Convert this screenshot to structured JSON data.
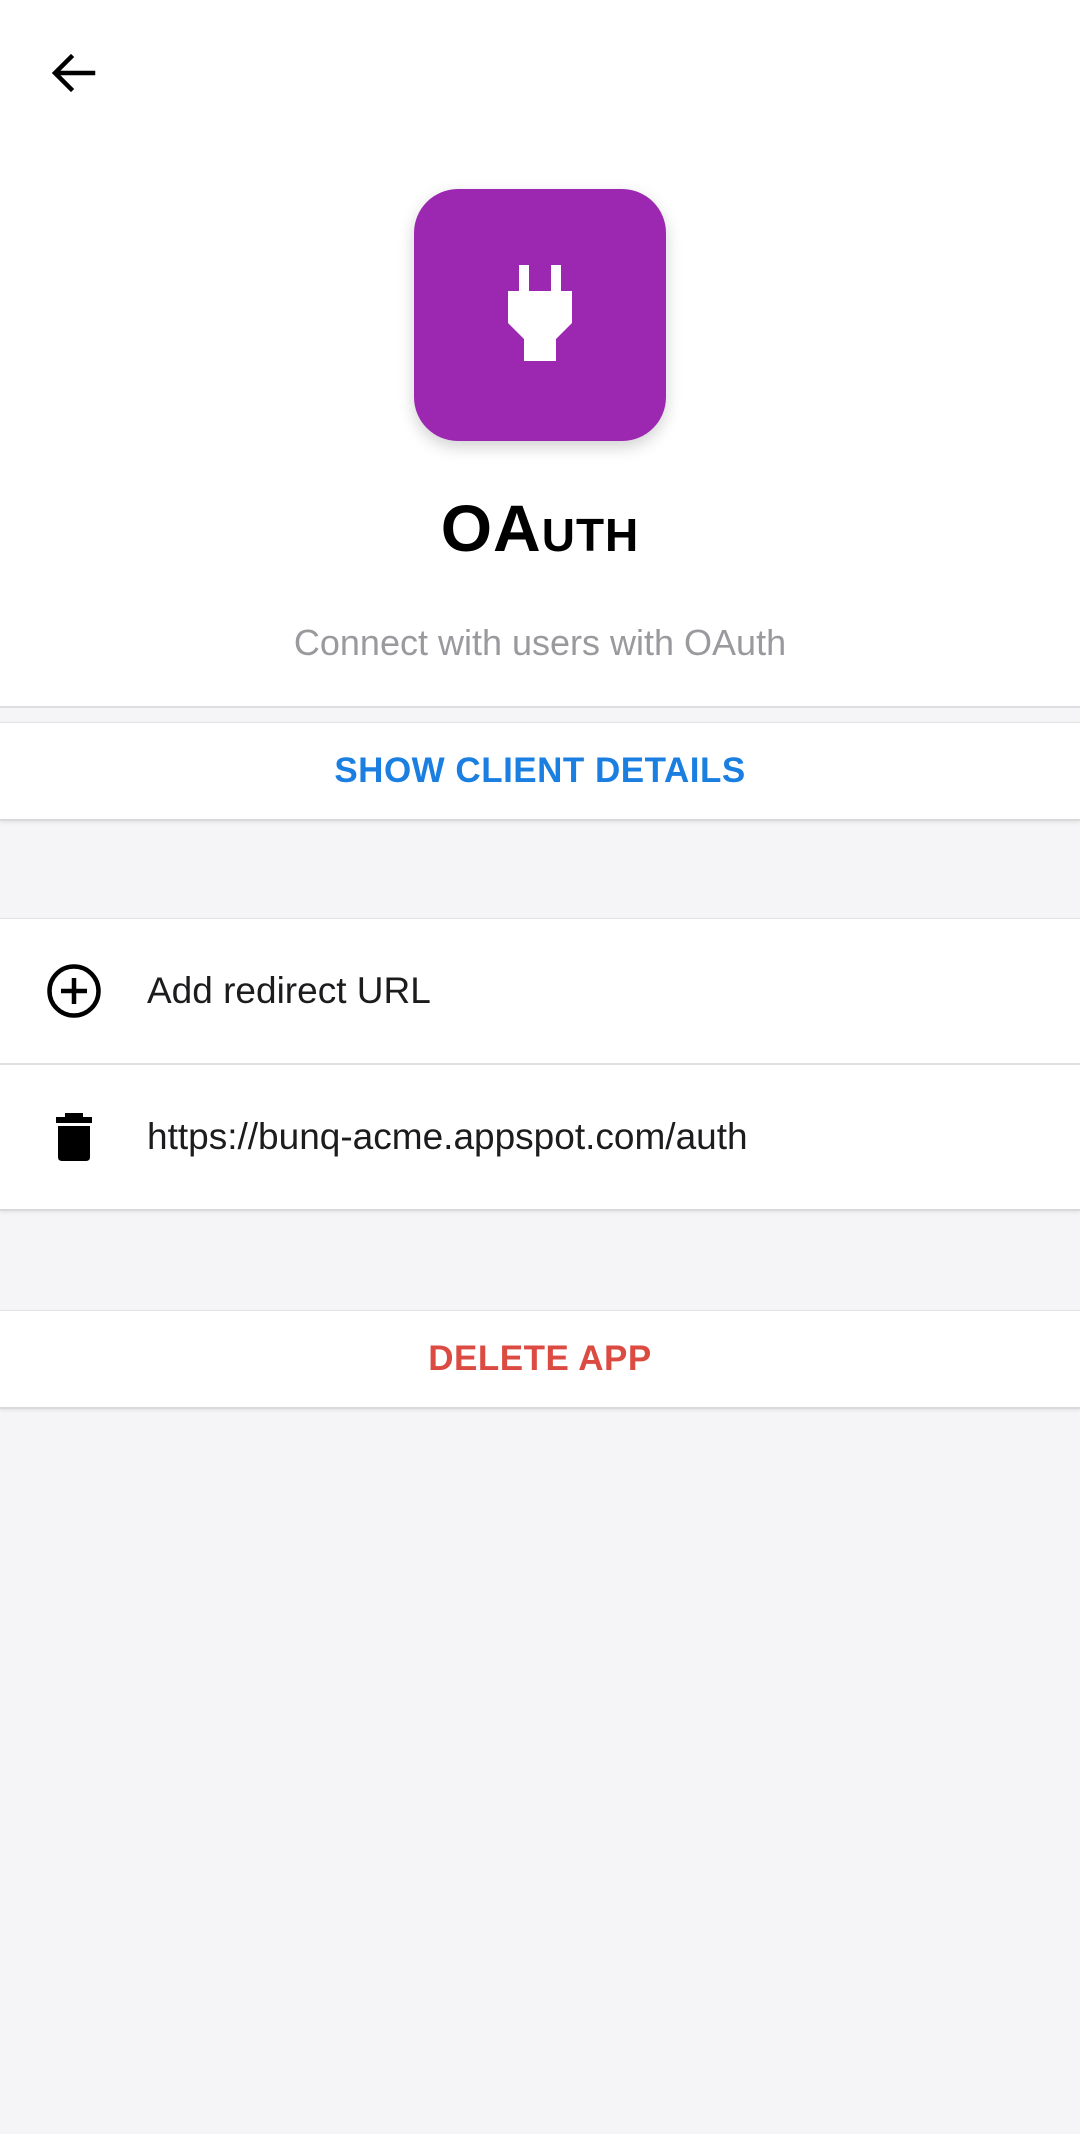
{
  "header": {
    "back_icon": "arrow-left-icon",
    "app_icon": "power-plug-icon",
    "app_icon_color": "#9c27b0",
    "title": "OAuth",
    "subtitle": "Connect with users with OAuth"
  },
  "client_details": {
    "label": "SHOW CLIENT DETAILS",
    "color": "#1a7fe0"
  },
  "redirects": {
    "add_label": "Add redirect URL",
    "add_icon": "plus-circle-icon",
    "urls": [
      {
        "url": "https://bunq-acme.appspot.com/auth",
        "icon": "trash-icon"
      }
    ]
  },
  "danger": {
    "delete_label": "DELETE APP",
    "color": "#dc4b42"
  }
}
